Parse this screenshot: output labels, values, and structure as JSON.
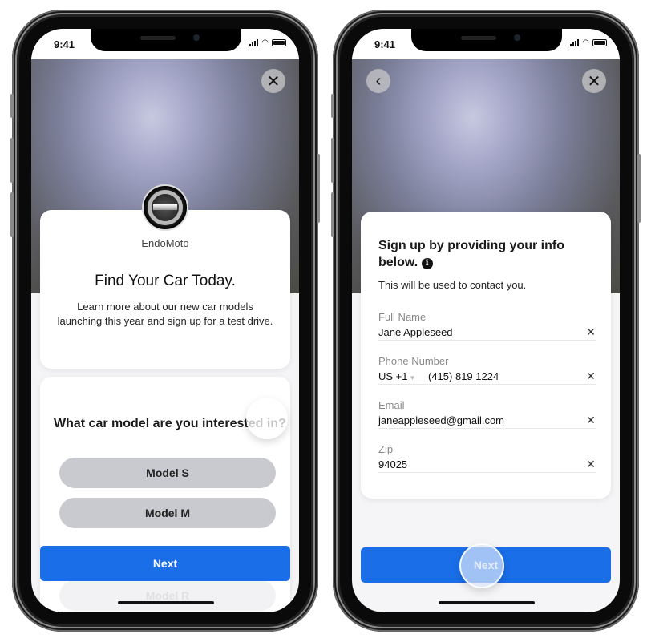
{
  "status_bar": {
    "time": "9:41"
  },
  "screen1": {
    "close_icon": "close-icon",
    "brand_name": "EndoMoto",
    "headline": "Find Your Car Today.",
    "description": "Learn more about our new car models launching this year and sign up for a test drive.",
    "question": "What car model are you interested in?",
    "options": [
      {
        "label": "Model S"
      },
      {
        "label": "Model M"
      },
      {
        "label": "Model R"
      }
    ],
    "next_label": "Next"
  },
  "screen2": {
    "back_icon": "chevron-left-icon",
    "close_icon": "close-icon",
    "title": "Sign up by providing your info below.",
    "subtitle": "This will be used to contact you.",
    "fields": {
      "full_name": {
        "label": "Full Name",
        "value": "Jane Appleseed"
      },
      "phone": {
        "label": "Phone Number",
        "country_code": "US +1",
        "value": "(415) 819 1224"
      },
      "email": {
        "label": "Email",
        "value": "janeappleseed@gmail.com"
      },
      "zip": {
        "label": "Zip",
        "value": "94025"
      }
    },
    "next_label": "Next"
  },
  "colors": {
    "primary": "#1a6ee8",
    "option_bg": "#c8cad0"
  }
}
